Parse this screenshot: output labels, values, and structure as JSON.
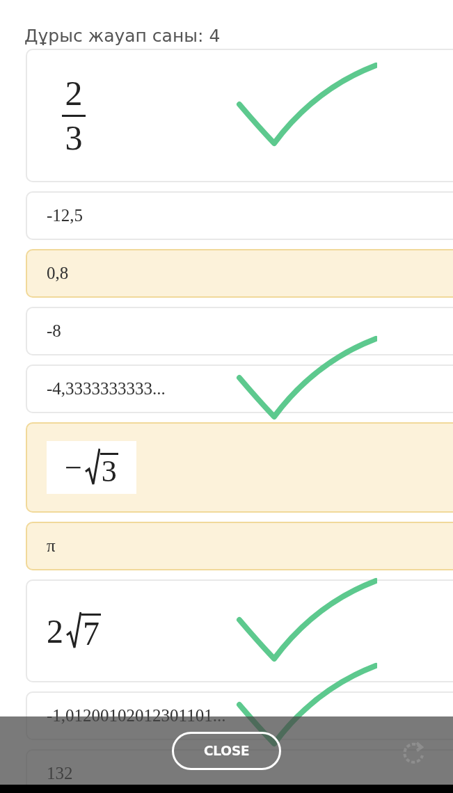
{
  "header": {
    "title": "Дұрыс жауап саны: 4"
  },
  "options": [
    {
      "kind": "fraction",
      "numerator": "2",
      "denominator": "3",
      "selected": false,
      "marked": true
    },
    {
      "kind": "text",
      "text": "-12,5",
      "selected": false,
      "marked": false
    },
    {
      "kind": "text",
      "text": "0,8",
      "selected": true,
      "marked": false
    },
    {
      "kind": "text",
      "text": "-8",
      "selected": false,
      "marked": false
    },
    {
      "kind": "text",
      "text": "-4,3333333333...",
      "selected": false,
      "marked": true
    },
    {
      "kind": "root",
      "coefficient": "−",
      "radicand": "3",
      "framed": true,
      "selected": true,
      "marked": false
    },
    {
      "kind": "text",
      "text": "π",
      "selected": true,
      "marked": false
    },
    {
      "kind": "root",
      "coefficient": "2",
      "radicand": "7",
      "framed": false,
      "selected": false,
      "marked": true
    },
    {
      "kind": "text",
      "text": "-1,01200102012301101...",
      "selected": false,
      "marked": true
    },
    {
      "kind": "text",
      "text": "132",
      "selected": false,
      "marked": false
    }
  ],
  "footer": {
    "button": "CLOSE"
  }
}
